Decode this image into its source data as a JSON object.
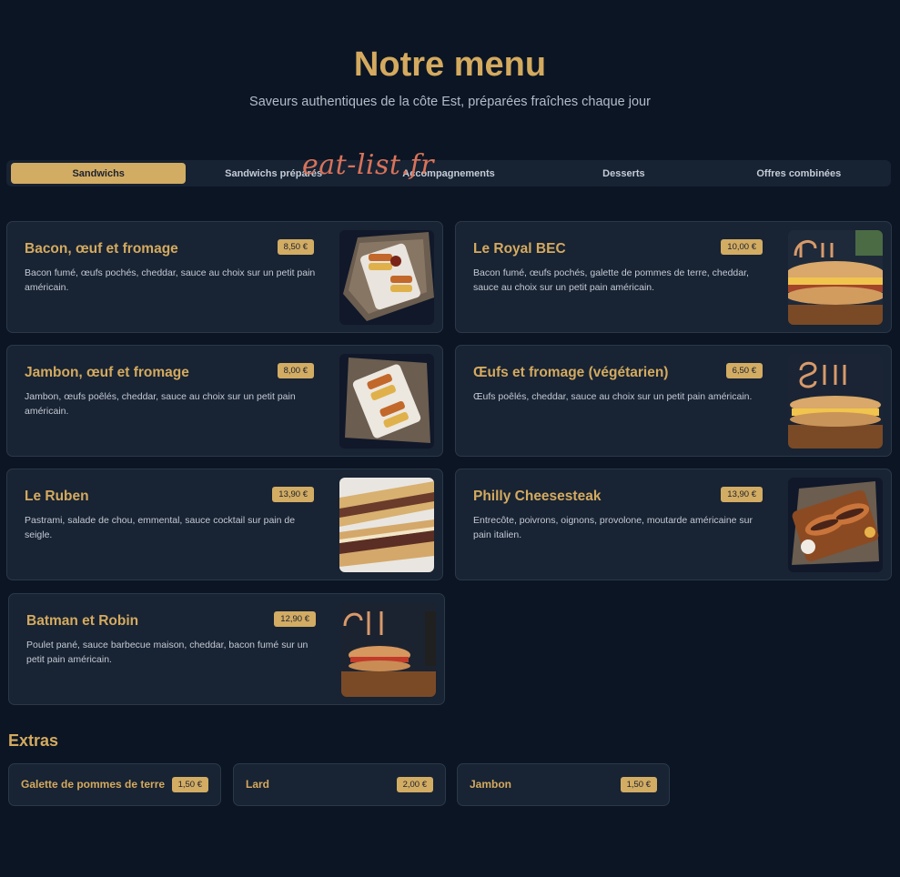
{
  "header": {
    "title": "Notre menu",
    "subtitle": "Saveurs authentiques de la côte Est, préparées fraîches chaque jour"
  },
  "watermark": "eat-list.fr",
  "tabs": [
    {
      "label": "Sandwichs",
      "active": true
    },
    {
      "label": "Sandwichs préparés",
      "active": false
    },
    {
      "label": "Accompagnements",
      "active": false
    },
    {
      "label": "Desserts",
      "active": false
    },
    {
      "label": "Offres combinées",
      "active": false
    }
  ],
  "items": [
    {
      "name": "Bacon, œuf et fromage",
      "price": "8,50 €",
      "description": "Bacon fumé, œufs pochés, cheddar, sauce au choix sur un petit pain américain.",
      "image": "sandwich-plate-photo"
    },
    {
      "name": "Le Royal BEC",
      "price": "10,00 €",
      "description": "Bacon fumé, œufs pochés, galette de pommes de terre, cheddar, sauce au choix sur un petit pain américain.",
      "image": "deli-sandwich-photo"
    },
    {
      "name": "Jambon, œuf et fromage",
      "price": "8,00 €",
      "description": "Jambon, œufs poêlés, cheddar, sauce au choix sur un petit pain américain.",
      "image": "sandwich-plate-photo"
    },
    {
      "name": "Œufs et fromage (végétarien)",
      "price": "6,50 €",
      "description": "Œufs poêlés, cheddar, sauce au choix sur un petit pain américain.",
      "image": "deli-sandwich-photo"
    },
    {
      "name": "Le Ruben",
      "price": "13,90 €",
      "description": "Pastrami, salade de chou, emmental, sauce cocktail sur pain de seigle.",
      "image": "grilled-sandwich-photo"
    },
    {
      "name": "Philly Cheesesteak",
      "price": "13,90 €",
      "description": "Entrecôte, poivrons, oignons, provolone, moutarde américaine sur pain italien.",
      "image": "cheesesteak-board-photo"
    },
    {
      "name": "Batman et Robin",
      "price": "12,90 €",
      "description": "Poulet pané, sauce barbecue maison, cheddar, bacon fumé sur un petit pain américain.",
      "image": "deli-sandwich-photo"
    }
  ],
  "extras": {
    "title": "Extras",
    "items": [
      {
        "name": "Galette de pommes de terre",
        "price": "1,50 €"
      },
      {
        "name": "Lard",
        "price": "2,00 €"
      },
      {
        "name": "Jambon",
        "price": "1,50 €"
      }
    ]
  },
  "colors": {
    "background": "#0b1524",
    "card": "#182333",
    "accent": "#d4aa5f",
    "badge": "#d2ac63"
  }
}
